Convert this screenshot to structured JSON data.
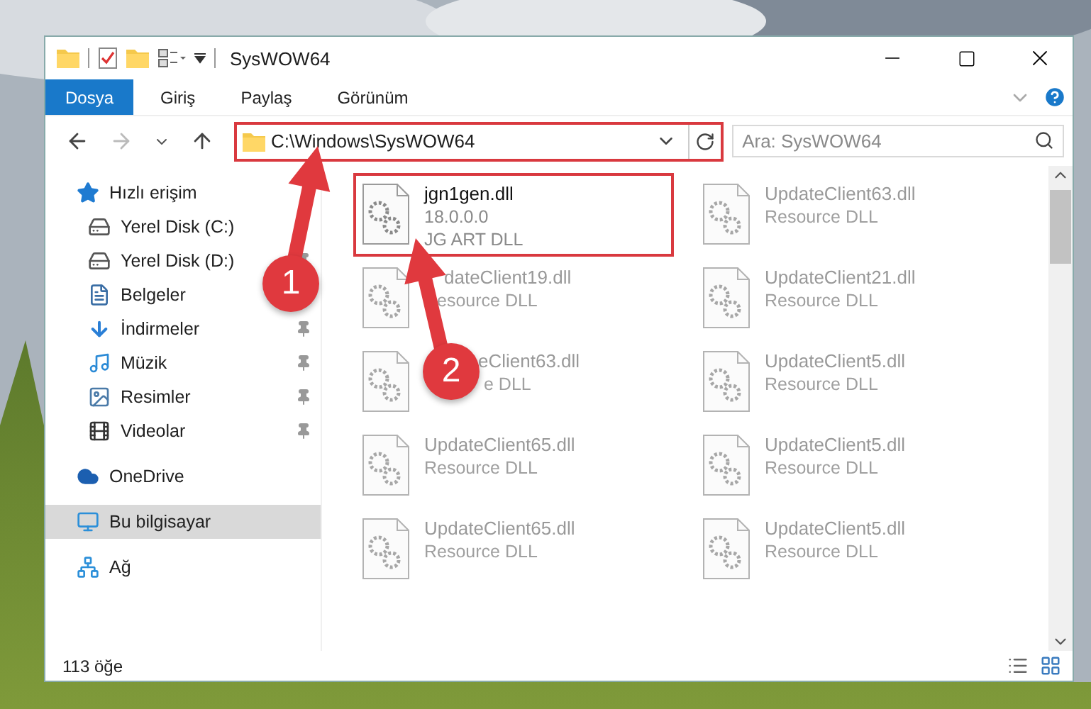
{
  "window": {
    "title": "SysWOW64"
  },
  "ribbon_tabs": [
    {
      "label": "Dosya",
      "selected": true
    },
    {
      "label": "Giriş",
      "selected": false
    },
    {
      "label": "Paylaş",
      "selected": false
    },
    {
      "label": "Görünüm",
      "selected": false
    }
  ],
  "address_bar": {
    "path": "C:\\Windows\\SysWOW64",
    "highlighted": true
  },
  "search": {
    "placeholder": "Ara: SysWOW64"
  },
  "nav": [
    {
      "label": "Hızlı erişim",
      "kind": "star",
      "selected": false,
      "children": [
        {
          "label": "Yerel Disk (C:)",
          "kind": "drive-c",
          "pinned": false,
          "selected": false
        },
        {
          "label": "Yerel Disk (D:)",
          "kind": "drive",
          "pinned": true,
          "selected": false
        },
        {
          "label": "Belgeler",
          "kind": "document",
          "pinned": false,
          "selected": false
        },
        {
          "label": "İndirmeler",
          "kind": "download",
          "pinned": true,
          "selected": false
        },
        {
          "label": "Müzik",
          "kind": "music",
          "pinned": true,
          "selected": false
        },
        {
          "label": "Resimler",
          "kind": "pictures",
          "pinned": true,
          "selected": false
        },
        {
          "label": "Videolar",
          "kind": "video",
          "pinned": true,
          "selected": false
        }
      ]
    },
    {
      "label": "OneDrive",
      "kind": "cloud",
      "selected": false
    },
    {
      "label": "Bu bilgisayar",
      "kind": "computer",
      "selected": true
    },
    {
      "label": "Ağ",
      "kind": "network",
      "selected": false
    }
  ],
  "files": [
    {
      "name": "jgn1gen.dll",
      "lines": [
        "18.0.0.0",
        "JG ART DLL"
      ],
      "highlighted": true,
      "blurred": false
    },
    {
      "name": "UpdateClient63.dll",
      "lines": [
        "Resource DLL"
      ],
      "highlighted": false,
      "blurred": true
    },
    {
      "name": "dateClient19.dll",
      "lines": [
        "esource DLL"
      ],
      "highlighted": false,
      "blurred": true,
      "covered": true
    },
    {
      "name": "UpdateClient21.dll",
      "lines": [
        "Resource DLL"
      ],
      "highlighted": false,
      "blurred": true
    },
    {
      "name": "eClient63.dll",
      "lines": [
        "e DLL"
      ],
      "highlighted": false,
      "blurred": true,
      "covered": true
    },
    {
      "name": "UpdateClient5.dll",
      "lines": [
        "Resource DLL"
      ],
      "highlighted": false,
      "blurred": true
    },
    {
      "name": "UpdateClient65.dll",
      "lines": [
        "Resource DLL"
      ],
      "highlighted": false,
      "blurred": true
    },
    {
      "name": "UpdateClient5.dll",
      "lines": [
        "Resource DLL"
      ],
      "highlighted": false,
      "blurred": true
    },
    {
      "name": "UpdateClient65.dll",
      "lines": [
        "Resource DLL"
      ],
      "highlighted": false,
      "blurred": true
    },
    {
      "name": "UpdateClient5.dll",
      "lines": [
        "Resource DLL"
      ],
      "highlighted": false,
      "blurred": true
    }
  ],
  "status_bar": {
    "count": "113 öğe"
  },
  "annotations": [
    {
      "label": "1"
    },
    {
      "label": "2"
    }
  ]
}
